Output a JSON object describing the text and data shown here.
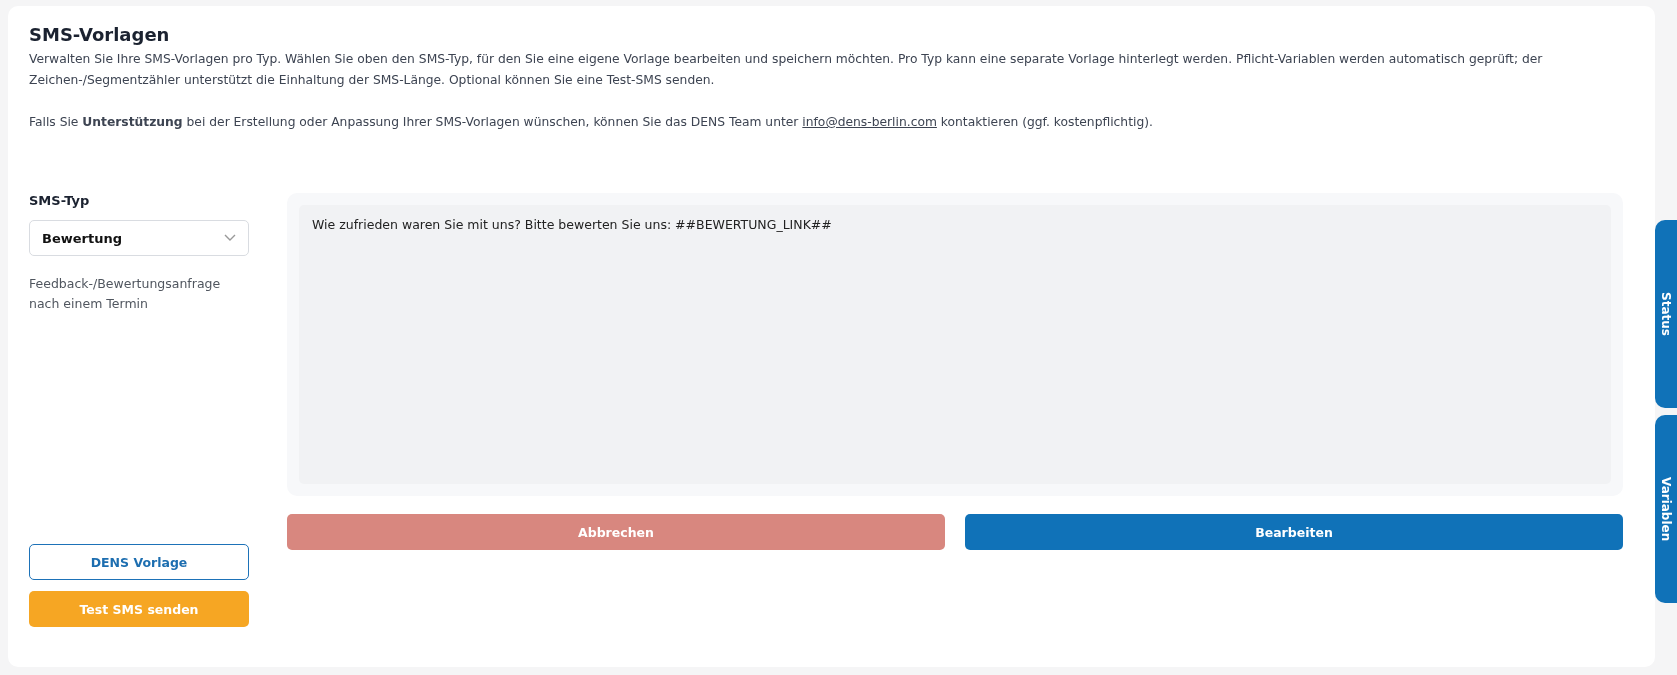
{
  "page": {
    "title": "SMS-Vorlagen",
    "intro": "Verwalten Sie Ihre SMS-Vorlagen pro Typ. Wählen Sie oben den SMS-Typ, für den Sie eine eigene Vorlage bearbeiten und speichern möchten. Pro Typ kann eine separate Vorlage hinterlegt werden. Pflicht-Variablen werden automatisch geprüft; der Zeichen-/Segmentzähler unterstützt die Einhaltung der SMS-Länge. Optional können Sie eine Test-SMS senden.",
    "support_before": "Falls Sie **Unterstützung** bei der Erstellung oder Anpassung Ihrer SMS-Vorlagen wünschen, können Sie das DENS Team unter",
    "support_link": "info@dens-berlin.com",
    "support_after": "kontaktieren (ggf. kostenpflichtig)."
  },
  "sms_type": {
    "label": "SMS-Typ",
    "value": "Bewertung",
    "description": "Feedback-/Bewertungsanfrage nach einem Termin"
  },
  "left_buttons": [
    {
      "label": "DENS Vorlage",
      "kind": "outline"
    },
    {
      "label": "Test SMS senden",
      "kind": "warning"
    }
  ],
  "editor": {
    "message": "Wie zufrieden waren Sie mit uns? Bitte bewerten Sie uns: ##BEWERTUNG_LINK##"
  },
  "actions": [
    {
      "label": "Abbrechen",
      "kind": "cancel"
    },
    {
      "label": "Bearbeiten",
      "kind": "primary"
    }
  ],
  "side_tabs": [
    {
      "label": "Status"
    },
    {
      "label": "Variablen"
    }
  ]
}
